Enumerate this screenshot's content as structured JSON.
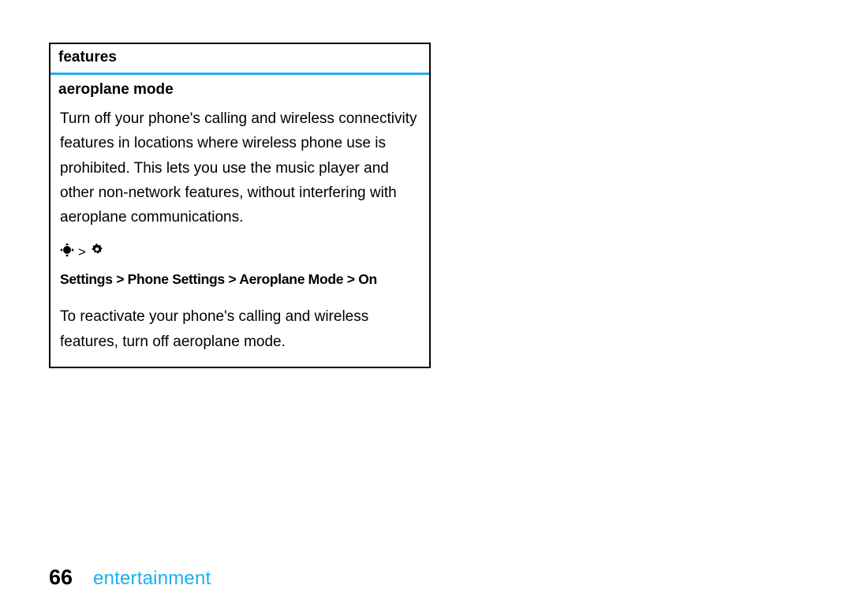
{
  "box": {
    "header": "features",
    "subhead": "aeroplane mode",
    "p1": "Turn off your phone's calling and wireless connectivity features in locations where wireless phone use is prohibited. This lets you use the music player and other non-network features, without interfering with aeroplane communications.",
    "nav": {
      "icon1": "nav-key-icon",
      "sep": ">",
      "icon2": "settings-icon",
      "path": "Settings > Phone Settings > Aeroplane Mode > On"
    },
    "p2": "To reactivate your phone's calling and wireless features, turn off aeroplane mode."
  },
  "footer": {
    "page": "66",
    "section": "entertainment"
  },
  "colors": {
    "accent": "#1daeef"
  }
}
